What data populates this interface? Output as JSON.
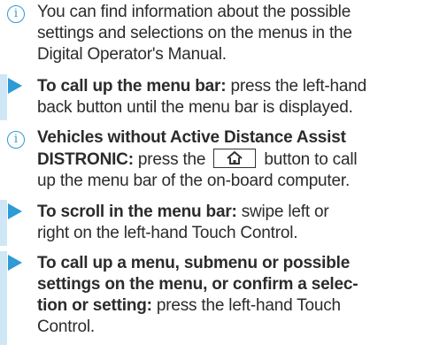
{
  "blocks": [
    {
      "type": "info",
      "icon": "info-icon",
      "lines": [
        "You can find information about the possible",
        "settings and selections on the menus in the",
        "Digital Operator's Manual."
      ]
    },
    {
      "type": "step",
      "icon": "step-arrow-icon",
      "bold": "To call up the menu bar:",
      "line1_rest": " press the left-hand",
      "line2": "back button until the menu bar is displayed."
    },
    {
      "type": "info",
      "icon": "info-icon",
      "bold_line1": "Vehicles without Active Distance Assist",
      "bold_line2": "DISTRONIC:",
      "line2_mid": " press the ",
      "key_icon": "home-icon",
      "line2_end": " button to call",
      "line3": "up the menu bar of the on-board computer."
    },
    {
      "type": "step",
      "icon": "step-arrow-icon",
      "bold": "To scroll in the menu bar:",
      "line1_rest": " swipe left or",
      "line2": "right on the left-hand Touch Control."
    },
    {
      "type": "step",
      "icon": "step-arrow-icon",
      "bold_line1": "To call up a menu, submenu or possible",
      "bold_line2": "settings on the menu, or confirm a selec-",
      "bold_line3": "tion or setting:",
      "line3_rest": " press the left-hand Touch",
      "line4": "Control."
    }
  ],
  "colors": {
    "accent": "#2e9bd6",
    "step_bar": "#cfe6f6",
    "text": "#2b2b2b"
  }
}
